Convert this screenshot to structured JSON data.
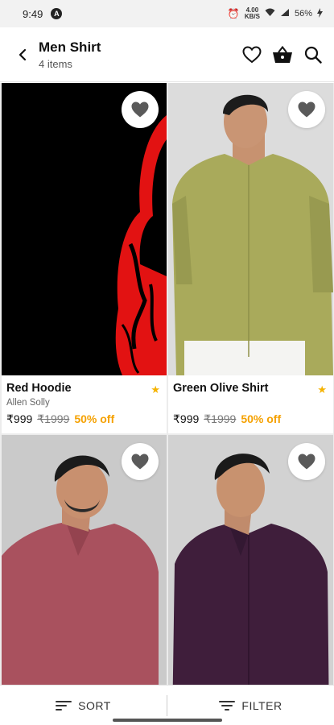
{
  "status_bar": {
    "time": "9:49",
    "speed_value": "4.00",
    "speed_unit": "KB/S",
    "battery": "56%"
  },
  "header": {
    "title": "Men Shirt",
    "count": "4 items"
  },
  "products": [
    {
      "name": "Red Hoodie",
      "brand": "Allen Solly",
      "price": "₹999",
      "mrp": "₹1999",
      "discount": "50% off"
    },
    {
      "name": "Green Olive Shirt",
      "brand": "",
      "price": "₹999",
      "mrp": "₹1999",
      "discount": "50% off"
    },
    {
      "name": "",
      "brand": "",
      "price": "",
      "mrp": "",
      "discount": ""
    },
    {
      "name": "",
      "brand": "",
      "price": "",
      "mrp": "",
      "discount": ""
    }
  ],
  "bottom_bar": {
    "sort_label": "SORT",
    "filter_label": "FILTER"
  },
  "colors": {
    "accent": "#f5a100",
    "star": "#f5b301"
  }
}
